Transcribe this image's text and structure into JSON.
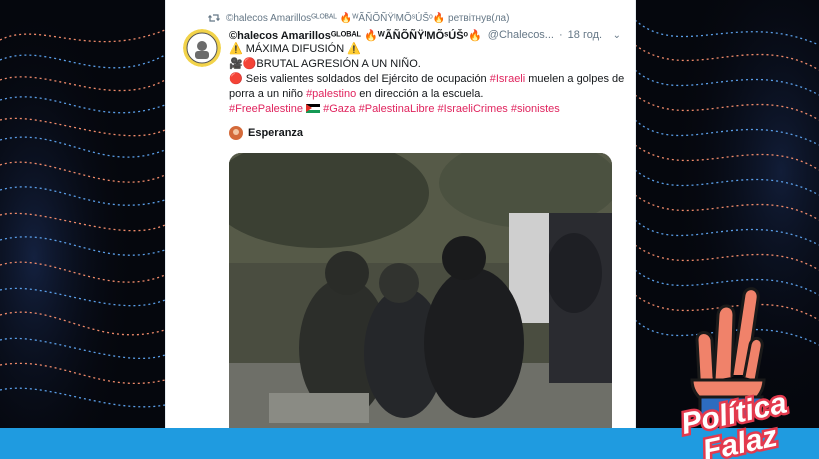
{
  "colors": {
    "background": "#05070d",
    "accent_bar": "#1f9be0",
    "hashtag": "#e0245e",
    "muted": "#657786"
  },
  "retweet": {
    "icon": "retweet-icon",
    "text": "©halecos Amarillosᴳᴸᴼᴮᴬᴸ 🔥ᵂÃÑÕÑŸᴵMÕˢÚŠᵒ🔥 ретвітнув(ла)"
  },
  "tweet": {
    "display_name": "©halecos Amarillosᴳᴸᴼᴮᴬᴸ 🔥ᵂÃÑÕÑŸᴵMÕˢÚŠᵒ🔥",
    "handle": "@Chalecos...",
    "separator": "·",
    "time": "18 год.",
    "menu_icon": "chevron-down-icon",
    "lines": {
      "l1": "⚠️ MÁXIMA DIFUSIÓN ⚠️",
      "l2": "🎥🔴BRUTAL AGRESIÓN A UN NIÑO.",
      "l3a": "🔴 Seis valientes soldados del Ejército de ocupación ",
      "l3tag": "#Israeli",
      "l3b": " muelen a golpes de",
      "l4a": "porra a un niño ",
      "l4tag": "#palestino",
      "l4b": " en dirección a la escuela.",
      "l5tag1": "#FreePalestine",
      "l5tag2": "#Gaza",
      "l5tag3": "#PalestinaLibre",
      "l5tag4": "#IsraeliCrimes",
      "l5tag5": "#sionistes"
    }
  },
  "quoted": {
    "name": "Esperanza",
    "avatar_icon": "user-avatar-icon"
  },
  "media": {
    "type": "video-still"
  },
  "logo": {
    "line1": "Política",
    "line2": "Falaz",
    "icon": "crossed-fingers-hand-icon"
  }
}
